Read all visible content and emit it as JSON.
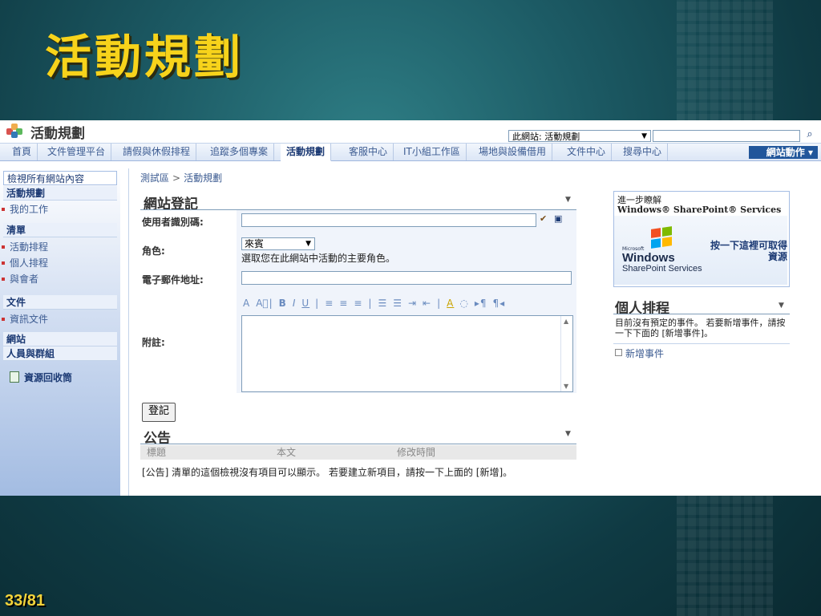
{
  "slide": {
    "title": "活動規劃",
    "page_number": "33/81"
  },
  "header": {
    "site_title": "活動規劃",
    "search_scope": "此網站: 活動規劃",
    "search_placeholder": "",
    "search_icon": "search-icon"
  },
  "topnav": {
    "tabs": [
      {
        "label": "首頁",
        "active": false
      },
      {
        "label": "文件管理平台",
        "active": false
      },
      {
        "label": "請假與休假排程",
        "active": false
      },
      {
        "label": "追蹤多個專案",
        "active": false
      },
      {
        "label": "活動規劃",
        "active": true
      },
      {
        "label": "客服中心",
        "active": false
      },
      {
        "label": "IT小組工作區",
        "active": false
      },
      {
        "label": "場地與設備借用",
        "active": false
      },
      {
        "label": "文件中心",
        "active": false
      },
      {
        "label": "搜尋中心",
        "active": false
      }
    ],
    "site_actions": "網站動作 ▾"
  },
  "leftnav": {
    "view_all": "檢視所有網站內容",
    "sections": [
      {
        "header": "活動規劃",
        "items": [
          "我的工作"
        ]
      },
      {
        "header": "清單",
        "items": [
          "活動排程",
          "個人排程",
          "與會者"
        ]
      },
      {
        "header": "文件",
        "items": [
          "資訊文件"
        ]
      },
      {
        "header": "網站",
        "items": []
      },
      {
        "header": "人員與群組",
        "items": []
      }
    ],
    "recycle_bin": "資源回收筒"
  },
  "breadcrumb": [
    "測試區",
    "活動規劃"
  ],
  "registration": {
    "title": "網站登記",
    "user_id_label": "使用者識別碼:",
    "role_label": "角色:",
    "role_value": "來賓",
    "role_help": "選取您在此網站中活動的主要角色。",
    "email_label": "電子郵件地址:",
    "email_value": "",
    "notes_label": "附註:",
    "toolbar": [
      "A",
      "A⃞|",
      "B",
      "I",
      "U",
      "|",
      "≡",
      "≡",
      "≡",
      "|",
      "☰",
      "☰",
      "⇥",
      "⇤",
      "|",
      "A",
      "◌",
      "▸¶",
      "¶◂"
    ],
    "submit": "登記"
  },
  "announcements": {
    "title": "公告",
    "columns": [
      "標題",
      "本文",
      "修改時間"
    ],
    "empty": "[公告] 清單的這個檢視沒有項目可以顯示。 若要建立新項目，請按一下上面的 [新增]。"
  },
  "learn_more": {
    "line1": "進一步瞭解",
    "line2": "Windows® SharePoint® Services",
    "ms": "Microsoft",
    "windows": "Windows",
    "sp_services": "SharePoint Services",
    "link": "按一下這裡可取得資源"
  },
  "personal_schedule": {
    "title": "個人排程",
    "message": "目前沒有預定的事件。 若要新增事件，請按一下下面的 [新增事件]。",
    "new_event": "新增事件"
  }
}
